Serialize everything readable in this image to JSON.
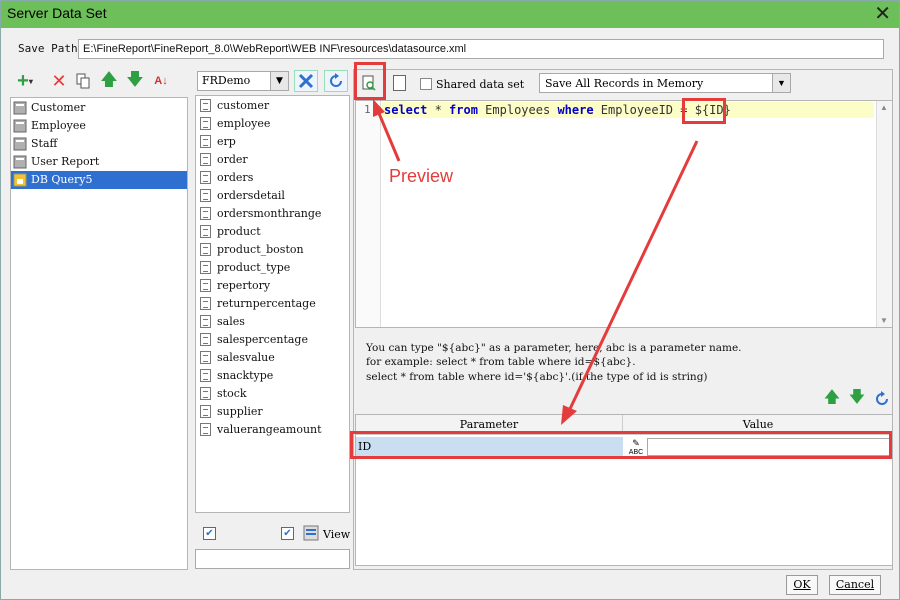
{
  "window": {
    "title": "Server Data Set",
    "close_icon": "close-icon"
  },
  "save_path": {
    "label": "Save Path:",
    "value": "E:\\FineReport\\FineReport_8.0\\WebReport\\WEB INF\\resources\\datasource.xml"
  },
  "left_toolbar": {
    "icons": [
      "add-icon",
      "delete-icon",
      "copy-icon",
      "move-up-icon",
      "move-down-icon",
      "sort-icon"
    ]
  },
  "datasets": [
    {
      "label": "Customer"
    },
    {
      "label": "Employee"
    },
    {
      "label": "Staff"
    },
    {
      "label": "User Report"
    },
    {
      "label": "DB Query5",
      "selected": true
    }
  ],
  "connection": {
    "selected": "FRDemo"
  },
  "tables": [
    "customer",
    "employee",
    "erp",
    "order",
    "orders",
    "ordersdetail",
    "ordersmonthrange",
    "product",
    "product_boston",
    "product_type",
    "repertory",
    "returnpercentage",
    "sales",
    "salespercentage",
    "salesvalue",
    "snacktype",
    "stock",
    "supplier",
    "valuerangeamount"
  ],
  "table_footer": {
    "view_label": "View"
  },
  "query_toolbar": {
    "shared_label": "Shared data set",
    "memory_option": "Save All Records in Memory"
  },
  "editor": {
    "line_number": "1",
    "kw_select": "select",
    "star": " * ",
    "kw_from": "from",
    "mid": " Employees ",
    "kw_where": "where",
    "tail": " EmployeeID = ",
    "param": "${ID}"
  },
  "hint": {
    "line1": "You can type \"${abc}\" as a parameter, here, abc is a parameter name.",
    "line2": "for example: select * from table where id=${abc}.",
    "line3": "select * from table where id='${abc}'.(if the type of id is string)"
  },
  "param_table": {
    "col_param": "Parameter",
    "col_value": "Value",
    "rows": [
      {
        "name": "ID",
        "type_icon": "ABC"
      }
    ]
  },
  "annotation": {
    "preview_label": "Preview"
  },
  "buttons": {
    "ok": "OK",
    "cancel": "Cancel"
  },
  "colors": {
    "accent": "#6dbf5a",
    "annotation": "#e43c3c",
    "selection": "#2f6fd0"
  }
}
